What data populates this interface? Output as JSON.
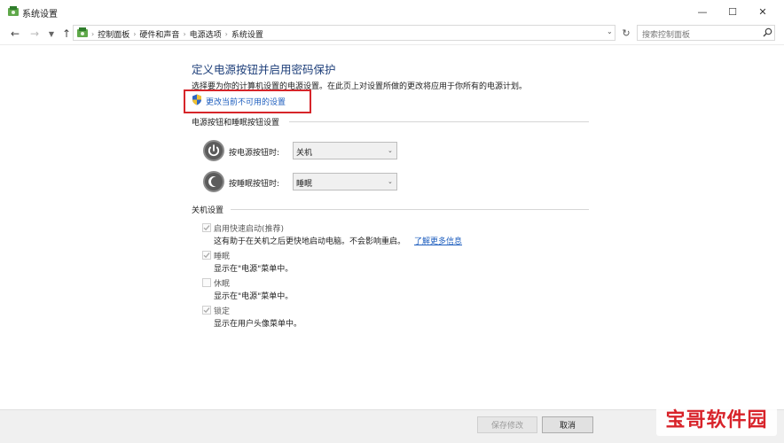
{
  "window": {
    "title": "系统设置",
    "controls": {
      "minimize": "—",
      "maximize": "☐",
      "close": "✕"
    }
  },
  "address_bar": {
    "breadcrumbs": [
      "控制面板",
      "硬件和声音",
      "电源选项",
      "系统设置"
    ],
    "search_placeholder": "搜索控制面板"
  },
  "page": {
    "heading": "定义电源按钮并启用密码保护",
    "description": "选择要为你的计算机设置的电源设置。在此页上对设置所做的更改将应用于你所有的电源计划。",
    "change_unavailable_link": "更改当前不可用的设置",
    "highlight_color": "#d6252a"
  },
  "power_buttons": {
    "section_label": "电源按钮和睡眠按钮设置",
    "rows": [
      {
        "label": "按电源按钮时:",
        "value": "关机"
      },
      {
        "label": "按睡眠按钮时:",
        "value": "睡眠"
      }
    ]
  },
  "shutdown": {
    "section_label": "关机设置",
    "options": [
      {
        "label": "启用快速启动(推荐)",
        "desc": "这有助于在关机之后更快地启动电脑。不会影响重启。",
        "link": "了解更多信息",
        "checked": true,
        "disabled": true
      },
      {
        "label": "睡眠",
        "desc": "显示在\"电源\"菜单中。",
        "checked": true,
        "disabled": true
      },
      {
        "label": "休眠",
        "desc": "显示在\"电源\"菜单中。",
        "checked": false,
        "disabled": true
      },
      {
        "label": "锁定",
        "desc": "显示在用户头像菜单中。",
        "checked": true,
        "disabled": true
      }
    ]
  },
  "footer": {
    "save_label": "保存修改",
    "cancel_label": "取消"
  },
  "watermark": "宝哥软件园"
}
